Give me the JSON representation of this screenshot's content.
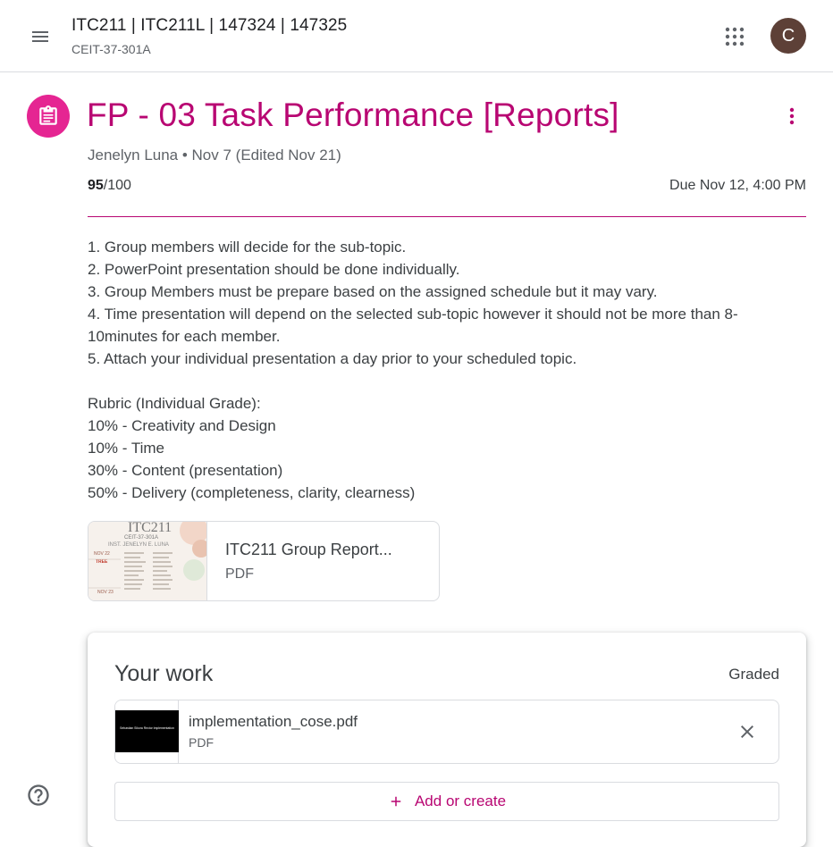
{
  "header": {
    "course_title": "ITC211 | ITC211L | 147324 | 147325",
    "course_section": "CEIT-37-301A",
    "menu_icon": "hamburger-menu-icon",
    "apps_icon": "google-apps-grid-icon",
    "avatar_letter": "C",
    "avatar_color": "#5d4037"
  },
  "assignment": {
    "icon": "assignment-clipboard-icon",
    "icon_color": "#e52592",
    "title": "FP - 03 Task Performance [Reports]",
    "title_color": "#b80672",
    "meta": "Jenelyn Luna • Nov 7 (Edited Nov 21)",
    "points_earned": "95",
    "points_total": "/100",
    "due": "Due Nov 12, 4:00 PM",
    "description_lines": [
      "1. Group members will decide for the sub-topic.",
      "2. PowerPoint presentation should be done individually.",
      "3. Group Members must be prepare based on the assigned schedule but it may vary.",
      "4. Time presentation will depend on the selected sub-topic however it should not be more than 8-",
      "10minutes for each member.",
      "5. Attach your individual presentation a day prior to your scheduled topic.",
      "",
      "Rubric (Individual Grade):",
      "10% - Creativity and Design",
      "10% - Time",
      "30% - Content (presentation)",
      "50% - Delivery (completeness, clarity, clearness)"
    ],
    "attachment": {
      "name": "ITC211 Group Report...",
      "type": "PDF",
      "thumb_title": "ITC211",
      "thumb_sub": "CEIT-37-301A",
      "thumb_inst": "INST. JENELYN E. LUNA",
      "thumb_date1": "NOV 22",
      "thumb_date2": "NOV 23"
    }
  },
  "your_work": {
    "heading": "Your work",
    "status": "Graded",
    "file_name": "implementation_cose.pdf",
    "file_type": "PDF",
    "thumb_text": "Sebastian Sikora Rector Implementation",
    "remove_icon": "close-icon",
    "add_label": "Add or create"
  },
  "help_icon": "help-circle-icon",
  "accent_color": "#b80672"
}
